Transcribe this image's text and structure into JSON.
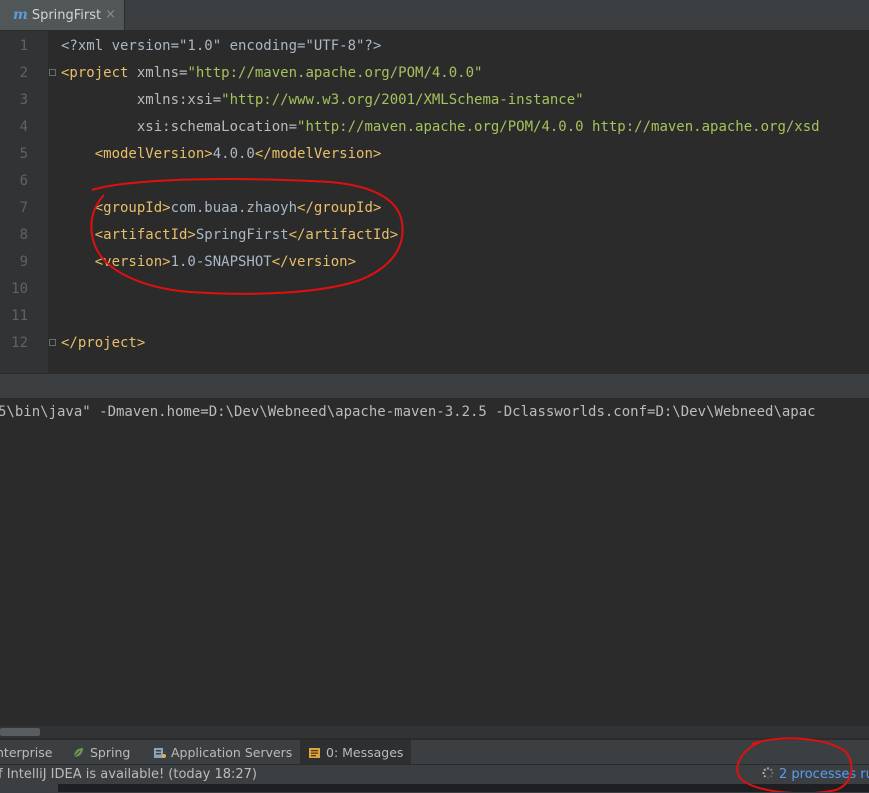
{
  "editor_tab": {
    "label": "SpringFirst",
    "icon": "maven-m-icon",
    "close": "×"
  },
  "code_lines": [
    {
      "n": "1",
      "segments": [
        {
          "t": "<?xml version=\"1.0\" encoding=\"UTF-8\"?>",
          "c": "txt"
        }
      ]
    },
    {
      "n": "2",
      "fold": true,
      "segments": [
        {
          "t": "<project ",
          "c": "tag"
        },
        {
          "t": "xmlns=",
          "c": "attr"
        },
        {
          "t": "\"http://maven.apache.org/POM/4.0.0\"",
          "c": "val"
        }
      ]
    },
    {
      "n": "3",
      "segments": [
        {
          "t": "         xmlns:xsi=",
          "c": "attr"
        },
        {
          "t": "\"http://www.w3.org/2001/XMLSchema-instance\"",
          "c": "val"
        }
      ]
    },
    {
      "n": "4",
      "segments": [
        {
          "t": "         xsi:schemaLocation=",
          "c": "attr"
        },
        {
          "t": "\"http://maven.apache.org/POM/4.0.0 http://maven.apache.org/xsd",
          "c": "val"
        }
      ]
    },
    {
      "n": "5",
      "segments": [
        {
          "t": "    <modelVersion>",
          "c": "tag"
        },
        {
          "t": "4.0.0",
          "c": "txt"
        },
        {
          "t": "</modelVersion>",
          "c": "tag"
        }
      ]
    },
    {
      "n": "6",
      "segments": []
    },
    {
      "n": "7",
      "segments": [
        {
          "t": "    <groupId>",
          "c": "tag"
        },
        {
          "t": "com.buaa.zhaoyh",
          "c": "txt"
        },
        {
          "t": "</groupId>",
          "c": "tag"
        }
      ]
    },
    {
      "n": "8",
      "segments": [
        {
          "t": "    <artifactId>",
          "c": "tag"
        },
        {
          "t": "SpringFirst",
          "c": "txt"
        },
        {
          "t": "</artifactId>",
          "c": "tag"
        }
      ]
    },
    {
      "n": "9",
      "segments": [
        {
          "t": "    <version>",
          "c": "tag"
        },
        {
          "t": "1.0-SNAPSHOT",
          "c": "txt"
        },
        {
          "t": "</version>",
          "c": "tag"
        }
      ]
    },
    {
      "n": "10",
      "segments": []
    },
    {
      "n": "11",
      "segments": []
    },
    {
      "n": "12",
      "fold": true,
      "segments": [
        {
          "t": "</project>",
          "c": "tag"
        }
      ]
    }
  ],
  "console": {
    "line": "5\\bin\\java\" -Dmaven.home=D:\\Dev\\Webneed\\apache-maven-3.2.5 -Dclassworlds.conf=D:\\Dev\\Webneed\\apac"
  },
  "tool_windows": [
    {
      "label": "nterprise",
      "icon": ""
    },
    {
      "label": "Spring",
      "icon": "spring-leaf-icon"
    },
    {
      "label": "Application Servers",
      "icon": "application-servers-icon"
    },
    {
      "label": "0: Messages",
      "icon": "messages-icon",
      "active": true
    }
  ],
  "status": {
    "message": "f IntelliJ IDEA is available! (today 18:27)",
    "processes": "2 processes ru"
  },
  "colors": {
    "background": "#2b2b2b",
    "gutter": "#313335",
    "tag": "#e8bf6a",
    "value": "#a5c25c",
    "link": "#589df6",
    "annotation": "#e01010"
  }
}
